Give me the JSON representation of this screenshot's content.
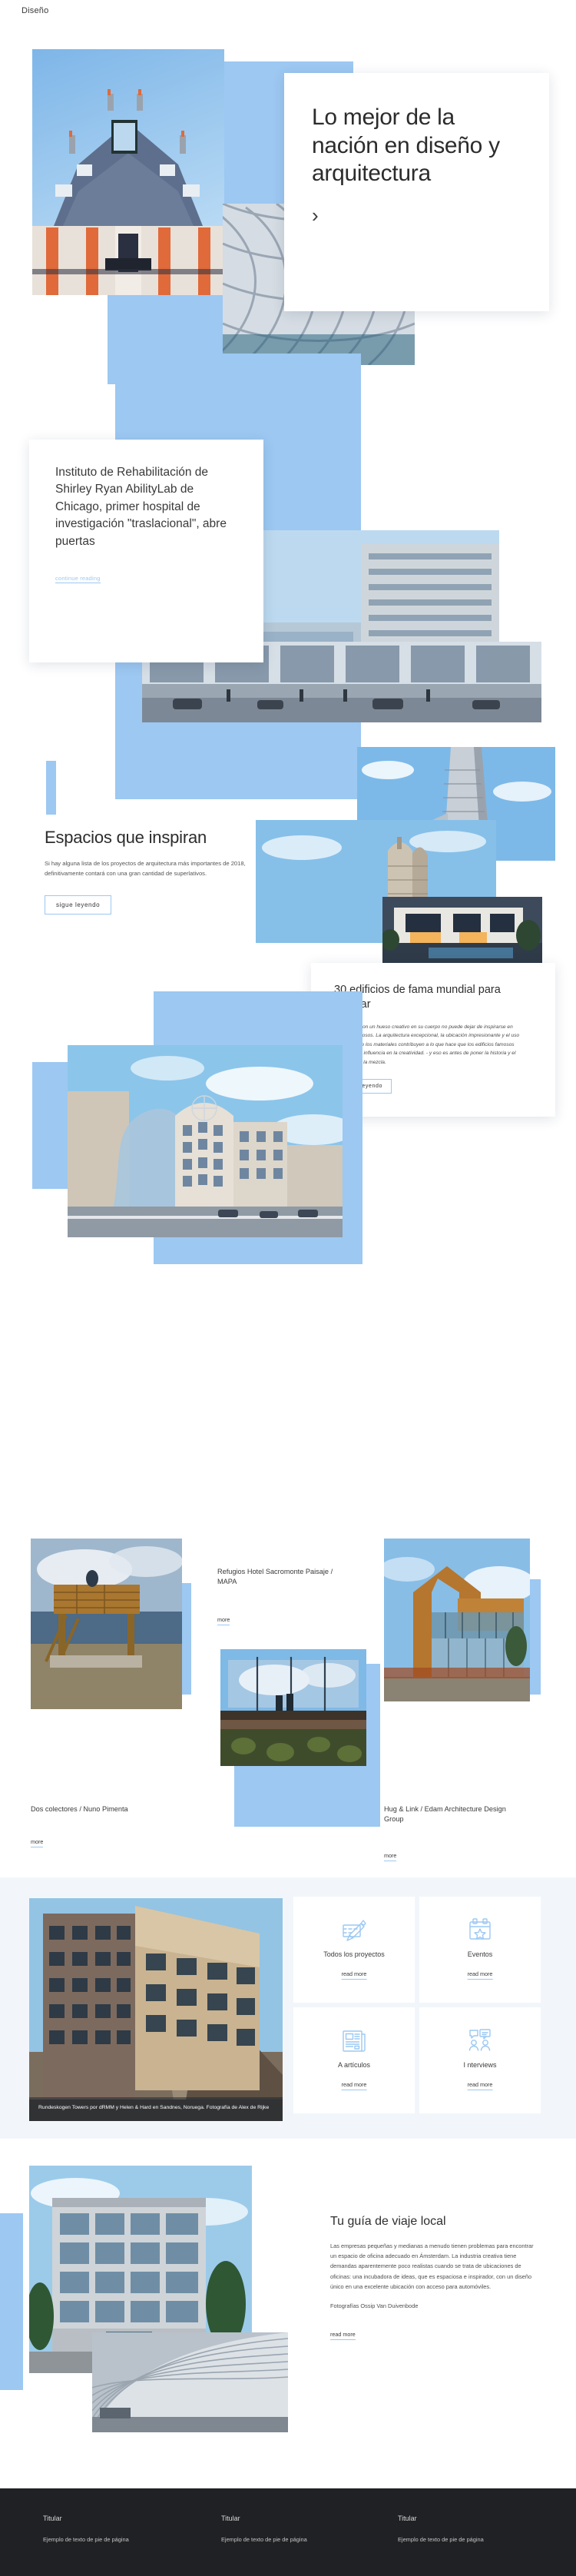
{
  "brand": "Diseño",
  "hero": {
    "title": "Lo mejor de la nación en diseño y arquitectura",
    "arrow": "›"
  },
  "institute": {
    "title": "Instituto de Rehabilitación de Shirley Ryan AbilityLab de Chicago, primer hospital de investigación \"traslacional\", abre puertas",
    "link": "continue reading"
  },
  "spaces": {
    "title": "Espacios que inspiran",
    "paragraph": "Si hay alguna lista de los proyectos de arquitectura más importantes de 2018, definitivamente contará con una gran cantidad de superlativos.",
    "button": "sigue leyendo"
  },
  "buildings": {
    "title": "30 edificios de fama mundial para inspirar",
    "paragraph": "Cualquiera con un hueso creativo en su cuerpo no puede dejar de inspirarse en edificios famosos. La arquitectura excepcional, la ubicación impresionante y el uso inteligente de los materiales contribuyen a lo que hace que los edificios famosos tengan tanta influencia en la creatividad. - y eso es antes de poner la historia y el propósito en la mezcla.",
    "button": "sigue leyendo"
  },
  "projects": [
    {
      "title": "Dos colectores / Nuno Pimenta",
      "link": "more"
    },
    {
      "title": "Refugios Hotel Sacromonte Paisaje / MAPA",
      "link": "more"
    },
    {
      "title": "Hug & Link / Edam Architecture Design Group",
      "link": "more"
    }
  ],
  "feature_image_caption": "Rundeskogen Towers por dRMM y Helen & Hard en Sandnes, Noruega. Fotografía de Alex de Rijke",
  "features": [
    {
      "icon": "pencil-ruler-icon",
      "label": "Todos los proyectos",
      "link": "read more"
    },
    {
      "icon": "calendar-star-icon",
      "label": "Eventos",
      "link": "read more"
    },
    {
      "icon": "newspaper-icon",
      "label": "A artículos",
      "link": "read more"
    },
    {
      "icon": "interview-chat-icon",
      "label": "I nterviews",
      "link": "read more"
    }
  ],
  "travel": {
    "title": "Tu guía de viaje local",
    "paragraph": "Las empresas pequeñas y medianas a menudo tienen problemas para encontrar un espacio de oficina adecuado en Ámsterdam. La industria creativa tiene demandas aparentemente poco realistas cuando se trata de ubicaciones de oficinas: una incubadora de ideas, que es espaciosa e inspirador, con un diseño único en una excelente ubicación con acceso para automóviles.",
    "credit": "Fotografías Ossip Van Duivenbode",
    "link": "read more"
  },
  "footer": {
    "columns": [
      {
        "title": "Titular",
        "text": "Ejemplo de texto de pie de página"
      },
      {
        "title": "Titular",
        "text": "Ejemplo de texto de pie de página"
      },
      {
        "title": "Titular",
        "text": "Ejemplo de texto de pie de página"
      }
    ]
  },
  "colors": {
    "accent_blue": "#9cc8f2",
    "pale_blue": "#e4edf8",
    "section_bg": "#f2f6fb",
    "footer_bg": "#1f2124"
  }
}
